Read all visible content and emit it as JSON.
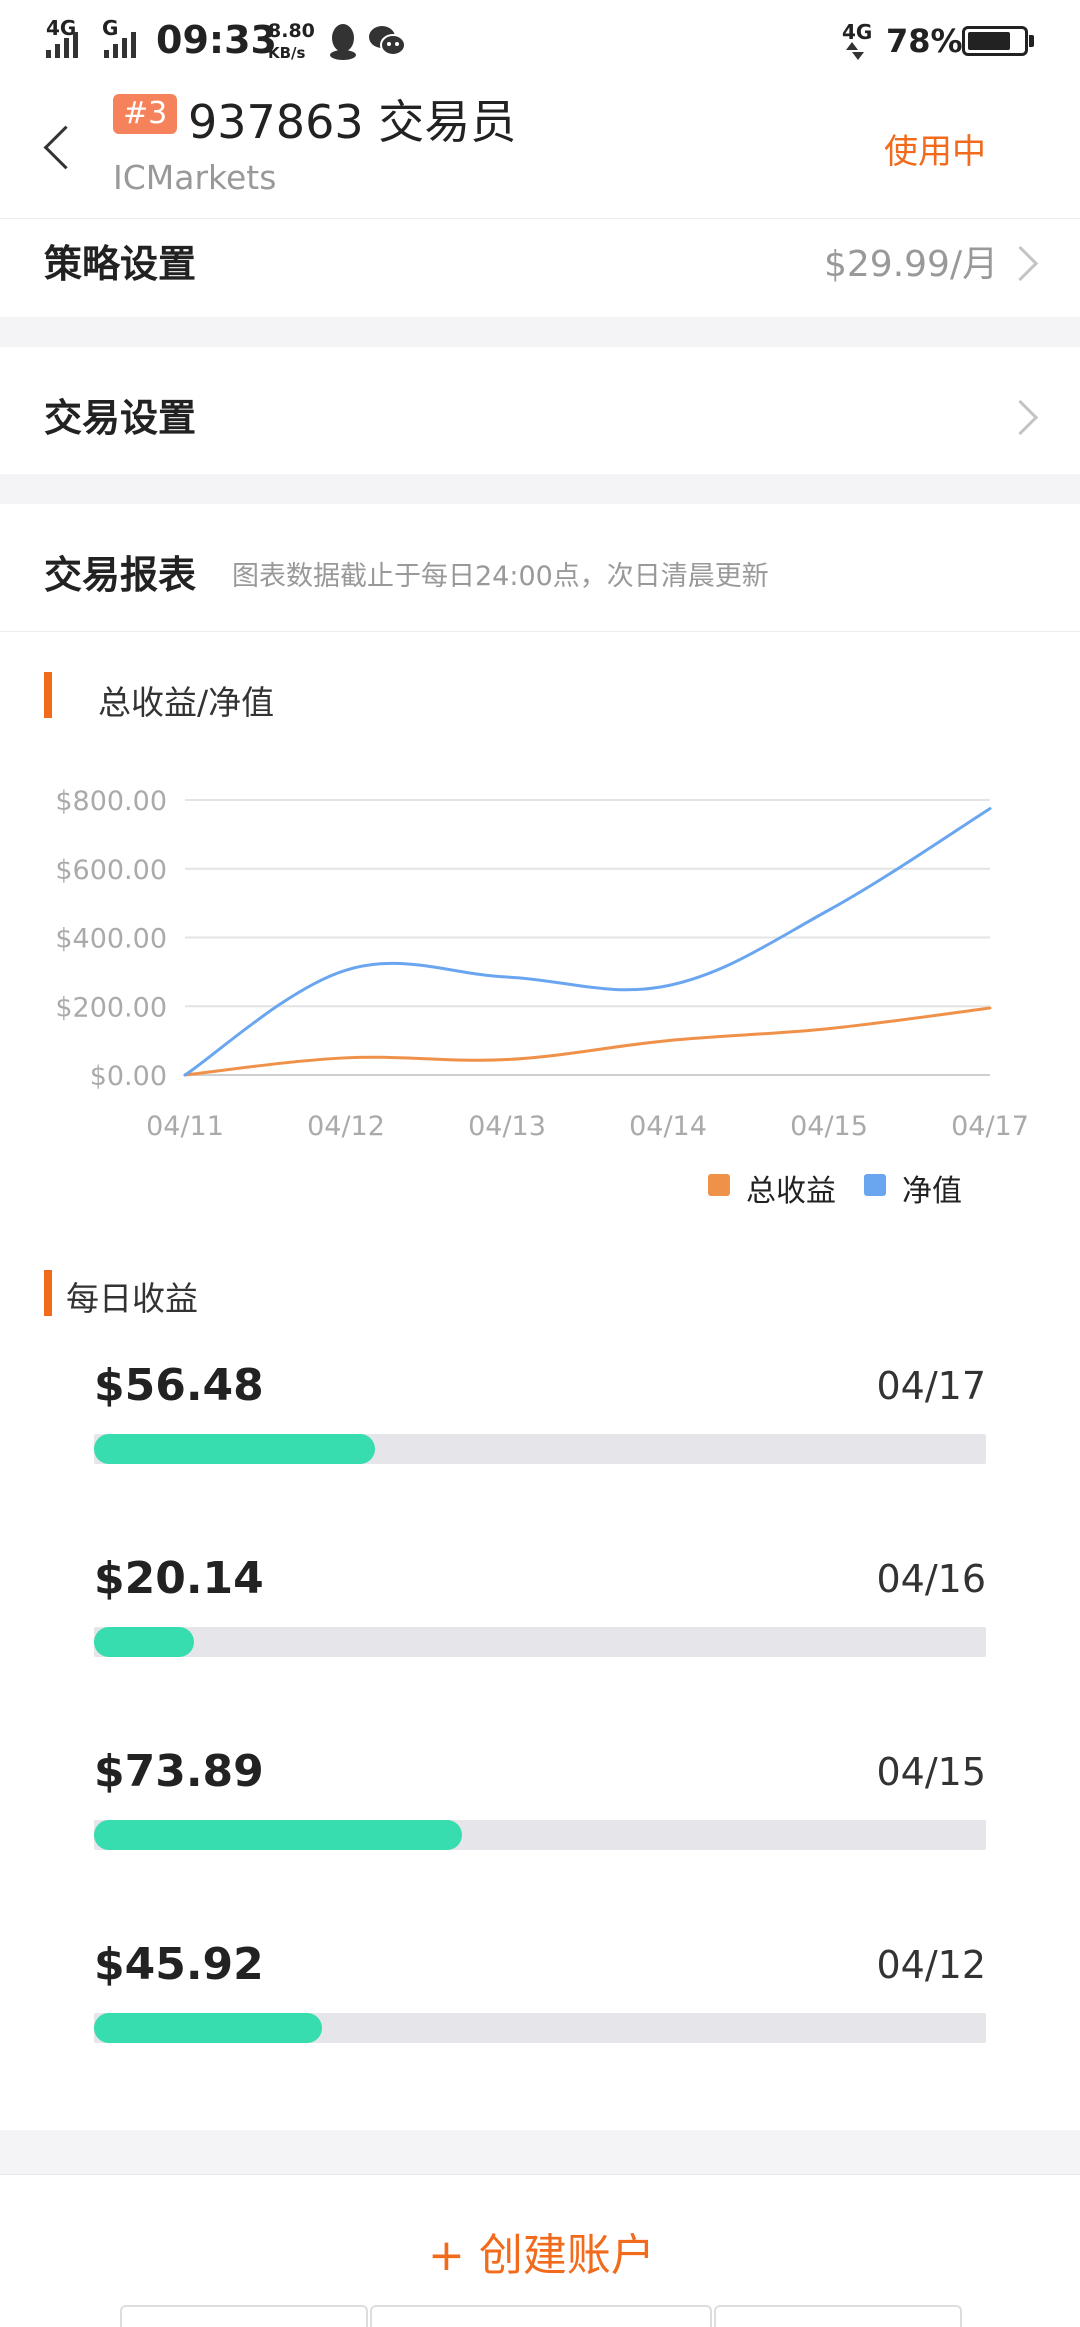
{
  "status_bar": {
    "net1": "4G",
    "net2": "G",
    "time": "09:33",
    "speed_value": "8.80",
    "speed_unit": "KB/s",
    "net_right": "4G",
    "battery": "78%",
    "battery_level": 0.78
  },
  "header": {
    "badge": "#3",
    "title": "937863 交易员",
    "subtitle": "ICMarkets",
    "status": "使用中"
  },
  "strategy": {
    "label": "策略设置",
    "price": "$29.99/月"
  },
  "trade_settings": {
    "label": "交易设置"
  },
  "report": {
    "title": "交易报表",
    "note": "图表数据截止于每日24:00点，次日清晨更新"
  },
  "chart_section": {
    "title": "总收益/净值"
  },
  "chart_data": {
    "type": "line",
    "title": "总收益/净值",
    "categories": [
      "04/11",
      "04/12",
      "04/13",
      "04/14",
      "04/15",
      "04/17"
    ],
    "yticks": [
      "$0.00",
      "$200.00",
      "$400.00",
      "$600.00",
      "$800.00"
    ],
    "ylim": [
      0,
      800
    ],
    "grid": true,
    "legend_position": "bottom-right",
    "series": [
      {
        "name": "总收益",
        "color": "#f0914a",
        "values": [
          0,
          50,
          45,
          100,
          135,
          195
        ]
      },
      {
        "name": "净值",
        "color": "#6aa6f0",
        "values": [
          0,
          305,
          285,
          260,
          480,
          775
        ]
      }
    ]
  },
  "daily_section": {
    "title": "每日收益",
    "items": [
      {
        "amount": "$56.48",
        "date": "04/17",
        "fraction": 0.315
      },
      {
        "amount": "$20.14",
        "date": "04/16",
        "fraction": 0.112
      },
      {
        "amount": "$73.89",
        "date": "04/15",
        "fraction": 0.412
      },
      {
        "amount": "$45.92",
        "date": "04/12",
        "fraction": 0.256
      }
    ]
  },
  "footer": {
    "create_label": "+ 创建账户",
    "accent": "#f26a1b"
  }
}
